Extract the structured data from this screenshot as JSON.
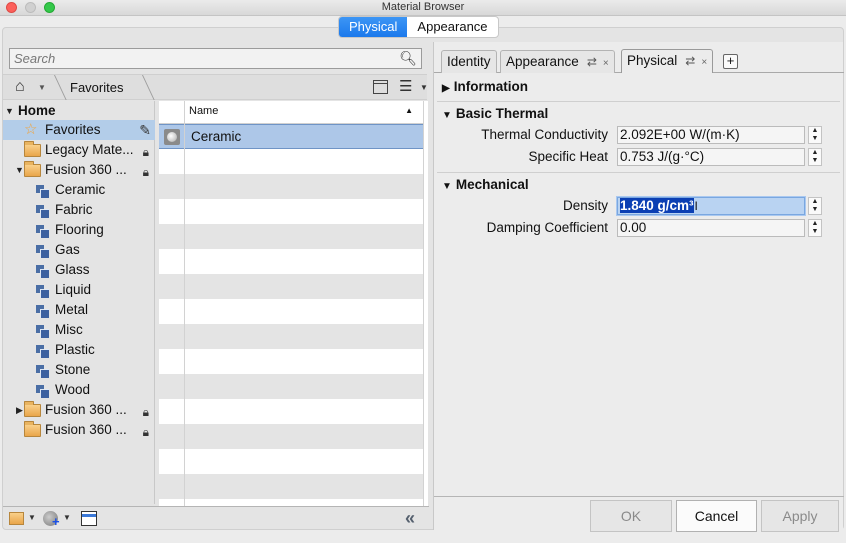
{
  "window": {
    "title": "Material Browser"
  },
  "mode_toggle": {
    "options": [
      "Physical",
      "Appearance"
    ],
    "selected": "Physical"
  },
  "search": {
    "placeholder": "Search",
    "value": ""
  },
  "breadcrumb": {
    "current": "Favorites"
  },
  "tree": {
    "root": "Home",
    "items": [
      {
        "label": "Favorites",
        "type": "favorites",
        "selected": true
      },
      {
        "label": "Legacy Mate...",
        "type": "folder",
        "locked": true
      },
      {
        "label": "Fusion 360 ...",
        "type": "folder",
        "locked": true,
        "expanded": true
      },
      {
        "label": "Ceramic",
        "type": "library"
      },
      {
        "label": "Fabric",
        "type": "library"
      },
      {
        "label": "Flooring",
        "type": "library"
      },
      {
        "label": "Gas",
        "type": "library"
      },
      {
        "label": "Glass",
        "type": "library"
      },
      {
        "label": "Liquid",
        "type": "library"
      },
      {
        "label": "Metal",
        "type": "library"
      },
      {
        "label": "Misc",
        "type": "library"
      },
      {
        "label": "Plastic",
        "type": "library"
      },
      {
        "label": "Stone",
        "type": "library"
      },
      {
        "label": "Wood",
        "type": "library"
      },
      {
        "label": "Fusion 360 ...",
        "type": "folder",
        "locked": true,
        "expanded": false
      },
      {
        "label": "Fusion 360 ...",
        "type": "folder",
        "locked": true
      }
    ]
  },
  "material_list": {
    "column_header": "Name",
    "sort": "ascending",
    "rows": [
      {
        "name": "Ceramic",
        "selected": true
      }
    ]
  },
  "editor": {
    "tabs": [
      {
        "label": "Identity"
      },
      {
        "label": "Appearance",
        "swap_icon": "⇄",
        "close_icon": "×"
      },
      {
        "label": "Physical",
        "swap_icon": "⇄",
        "close_icon": "×",
        "active": true
      }
    ],
    "add_tab": "+",
    "sections": {
      "information": {
        "title": "Information",
        "expanded": false
      },
      "basic_thermal": {
        "title": "Basic Thermal",
        "expanded": true,
        "properties": [
          {
            "label": "Thermal Conductivity",
            "value": "2.092E+00 W/(m·K)"
          },
          {
            "label": "Specific Heat",
            "value": "0.753 J/(g·°C)"
          }
        ]
      },
      "mechanical": {
        "title": "Mechanical",
        "expanded": true,
        "properties": [
          {
            "label": "Density",
            "value": "1.840 g/cm³",
            "focused": true
          },
          {
            "label": "Damping Coefficient",
            "value": "0.00"
          }
        ]
      }
    },
    "buttons": {
      "ok": "OK",
      "cancel": "Cancel",
      "apply": "Apply"
    }
  },
  "colors": {
    "accent": "#1b79ec",
    "selection": "#b3cde9",
    "text_selection": "#0b3fb3"
  }
}
